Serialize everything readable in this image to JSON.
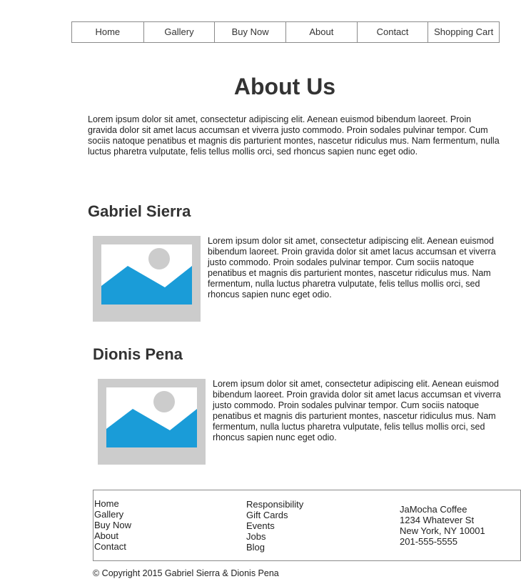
{
  "nav": {
    "items": [
      "Home",
      "Gallery",
      "Buy Now",
      "About",
      "Contact",
      "Shopping Cart"
    ]
  },
  "page": {
    "title": "About Us",
    "intro": "Lorem ipsum dolor sit amet, consectetur adipiscing elit. Aenean euismod bibendum laoreet. Proin gravida dolor sit amet lacus accumsan et viverra justo commodo. Proin sodales pulvinar tempor. Cum sociis natoque penatibus et magnis dis parturient montes, nascetur ridiculus mus. Nam fermentum, nulla luctus pharetra vulputate, felis tellus mollis orci, sed rhoncus sapien nunc eget odio."
  },
  "people": [
    {
      "name": "Gabriel Sierra",
      "bio": "Lorem ipsum dolor sit amet, consectetur adipiscing elit. Aenean euismod bibendum laoreet. Proin gravida dolor sit amet lacus accumsan et viverra justo commodo. Proin sodales pulvinar tempor. Cum sociis natoque penatibus et magnis dis parturient montes, nascetur ridiculus mus. Nam fermentum, nulla luctus pharetra vulputate, felis tellus mollis orci, sed rhoncus sapien nunc eget odio."
    },
    {
      "name": "Dionis Pena",
      "bio": "Lorem ipsum dolor sit amet, consectetur adipiscing elit. Aenean euismod bibendum laoreet. Proin gravida dolor sit amet lacus accumsan et viverra justo commodo. Proin sodales pulvinar tempor. Cum sociis natoque penatibus et magnis dis parturient montes, nascetur ridiculus mus. Nam fermentum, nulla luctus pharetra vulputate, felis tellus mollis orci, sed rhoncus sapien nunc eget odio."
    }
  ],
  "footer": {
    "nav_links": [
      "Home",
      "Gallery",
      "Buy Now",
      "About",
      "Contact"
    ],
    "extra_links": [
      "Responsibility",
      "Gift Cards",
      "Events",
      "Jobs",
      "Blog"
    ],
    "address": [
      "JaMocha Coffee",
      "1234 Whatever St",
      "New York, NY 10001",
      "201-555-5555"
    ],
    "copyright": "© Copyright 2015 Gabriel Sierra & Dionis Pena"
  },
  "colors": {
    "image_placeholder_bg": "#cccccc",
    "image_mountain": "#1a9cd8",
    "text": "#333333"
  },
  "icons": {
    "profile_photo": "image-placeholder-icon"
  }
}
